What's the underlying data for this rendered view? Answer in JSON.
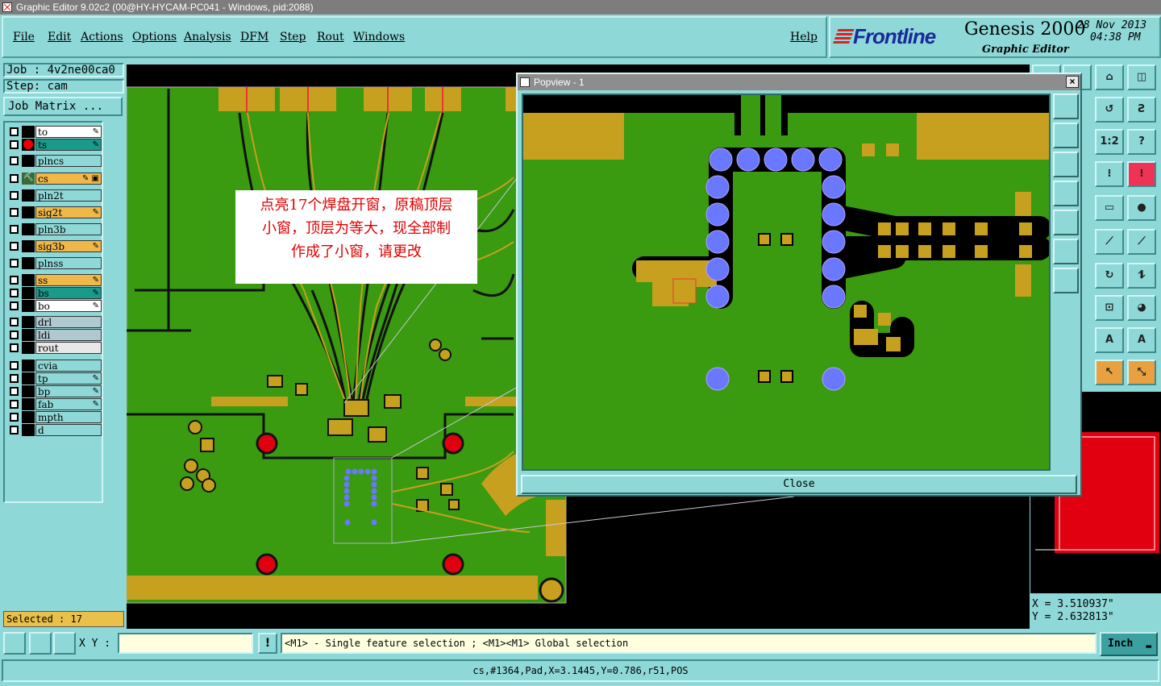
{
  "window": {
    "title": "Graphic Editor 9.02c2 (00@HY-HYCAM-PC041 - Windows, pid:2088)"
  },
  "menu": {
    "items": [
      "File",
      "Edit",
      "Actions",
      "Options",
      "Analysis",
      "DFM",
      "Step",
      "Rout",
      "Windows"
    ],
    "help": "Help"
  },
  "brand": {
    "logo": "Frontline",
    "product": "Genesis 2000",
    "subtitle": "Graphic Editor",
    "date": "28 Nov 2013",
    "time": "04:38 PM"
  },
  "job": {
    "job_label": "Job : 4v2ne00ca0",
    "step_label": "Step: cam",
    "matrix_button": "Job Matrix ..."
  },
  "layers": [
    {
      "name": "to",
      "color": "#ffffff",
      "marker": "✎"
    },
    {
      "name": "ts",
      "color": "#1a9a8a",
      "marker": "✎",
      "indicator": "red-dot"
    },
    {
      "name": "plncs",
      "color": "#8fd8d8",
      "marker": ""
    },
    {
      "name": "cs",
      "color": "#f0b848",
      "marker": "✎ ▣",
      "indicator": "work-layer"
    },
    {
      "name": "pln2t",
      "color": "#8fd8d8",
      "marker": ""
    },
    {
      "name": "sig2t",
      "color": "#f0b848",
      "marker": "✎"
    },
    {
      "name": "pln3b",
      "color": "#8fd8d8",
      "marker": ""
    },
    {
      "name": "sig3b",
      "color": "#f0b848",
      "marker": "✎"
    },
    {
      "name": "plnss",
      "color": "#8fd8d8",
      "marker": ""
    },
    {
      "name": "ss",
      "color": "#f0b848",
      "marker": "✎"
    },
    {
      "name": "bs",
      "color": "#1a9a8a",
      "marker": "✎"
    },
    {
      "name": "bo",
      "color": "#ffffff",
      "marker": "✎"
    },
    {
      "name": "drl",
      "color": "#b0c8d0",
      "marker": ""
    },
    {
      "name": "ldi",
      "color": "#b0c8d0",
      "marker": ""
    },
    {
      "name": "rout",
      "color": "#e8e8e8",
      "marker": ""
    },
    {
      "name": "cvia",
      "color": "#8fd8d8",
      "marker": ""
    },
    {
      "name": "tp",
      "color": "#8fd8d8",
      "marker": "✎"
    },
    {
      "name": "bp",
      "color": "#8fd8d8",
      "marker": "✎"
    },
    {
      "name": "fab",
      "color": "#8fd8d8",
      "marker": "✎"
    },
    {
      "name": "mpth",
      "color": "#8fd8d8",
      "marker": ""
    },
    {
      "name": "d",
      "color": "#8fd8d8",
      "marker": ""
    }
  ],
  "selection": {
    "text": "Selected : 17"
  },
  "annotation": {
    "line1": "点亮17个焊盘开窗，原稿顶层",
    "line2": "小窗，顶层为等大，现全部制",
    "line3": "作成了小窗，请更改"
  },
  "popview": {
    "title": "Popview - 1",
    "close_x": "×",
    "close_button": "Close"
  },
  "tools": {
    "ratio_label": "1:2"
  },
  "coordinates": {
    "x": "X = 3.510937\"",
    "y": "Y = 2.632813\""
  },
  "command": {
    "xy_label": "X Y :",
    "xy_value": "",
    "warn": "!",
    "hint": "<M1> - Single feature selection ; <M1><M1> Global selection",
    "unit": "Inch"
  },
  "status": {
    "feature_info": "cs,#1364,Pad,X=3.1445,Y=0.786,r51,POS"
  },
  "colors": {
    "board": "#3a9a10",
    "copper": "#c8a020",
    "pad_selected": "#6a78ff",
    "drill": "#e00010",
    "panel": "#8fd8d8"
  }
}
